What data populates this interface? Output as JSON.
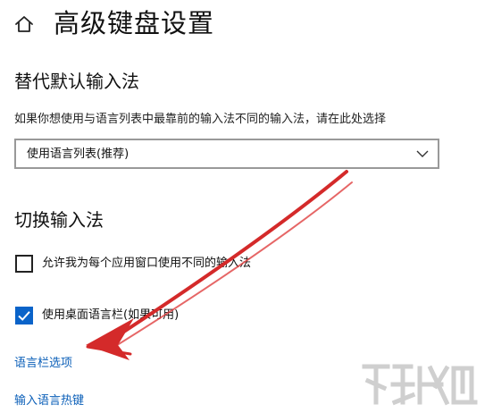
{
  "header": {
    "title": "高级键盘设置",
    "home_icon": "home-icon"
  },
  "override_section": {
    "heading": "替代默认输入法",
    "description": "如果你想使用与语言列表中最靠前的输入法不同的输入法，请在此处选择",
    "dropdown_value": "使用语言列表(推荐)",
    "dropdown_icon": "chevron-down-icon"
  },
  "switch_section": {
    "heading": "切换输入法",
    "per_app_checkbox": {
      "label": "允许我为每个应用窗口使用不同的输入法",
      "checked": false
    },
    "langbar_checkbox": {
      "label": "使用桌面语言栏(如果可用)",
      "checked": true
    }
  },
  "links": {
    "langbar_options": "语言栏选项",
    "input_hotkeys": "输入语言热键"
  },
  "colors": {
    "accent": "#0a63c9",
    "link": "#0b5fb8",
    "annotation_arrow": "#d42a2a"
  }
}
